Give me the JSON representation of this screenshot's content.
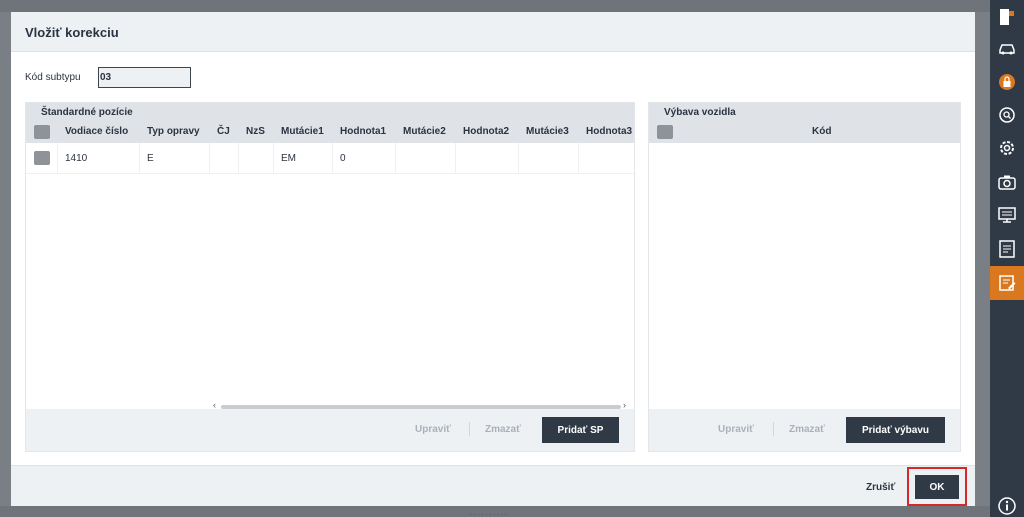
{
  "dialog": {
    "title": "Vložiť korekciu",
    "subtype_label": "Kód subtypu",
    "subtype_value": "03"
  },
  "left_panel": {
    "title": "Štandardné pozície",
    "columns": [
      "Vodiace číslo",
      "Typ opravy",
      "ČJ",
      "NzS",
      "Mutácie1",
      "Hodnota1",
      "Mutácie2",
      "Hodnota2",
      "Mutácie3",
      "Hodnota3"
    ],
    "rows": [
      {
        "vodiace_cislo": "1410",
        "typ_opravy": "E",
        "cj": "",
        "nzs": "",
        "mutacie1": "EM",
        "hodnota1": "0"
      }
    ],
    "scroll_left": "‹",
    "scroll_right": "›",
    "buttons": {
      "edit": "Upraviť",
      "delete": "Zmazať",
      "add": "Pridať SP"
    }
  },
  "right_panel": {
    "title": "Výbava vozidla",
    "columns": [
      "Kód"
    ],
    "buttons": {
      "edit": "Upraviť",
      "delete": "Zmazať",
      "add": "Pridať výbavu"
    }
  },
  "footer": {
    "cancel": "Zrušiť",
    "ok": "OK"
  },
  "sidebar": {
    "icons": [
      "exit-icon",
      "car-icon",
      "lock-icon",
      "search-icon",
      "gear-icon",
      "camera-icon",
      "monitor-icon",
      "checklist-icon",
      "edit-document-icon",
      "info-icon"
    ],
    "active": "edit-document-icon",
    "accent": "#d9781f"
  }
}
